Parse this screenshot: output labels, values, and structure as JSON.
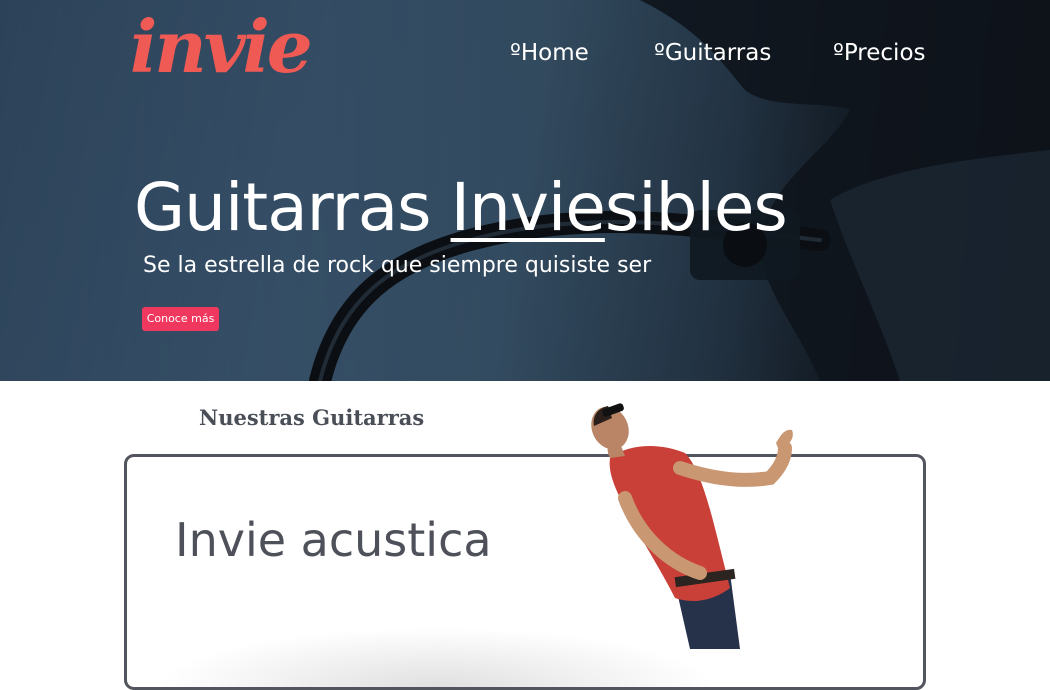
{
  "brand": {
    "logo_text": "invie",
    "logo_color": "#f05a55"
  },
  "nav": {
    "items": [
      {
        "label": "ºHome"
      },
      {
        "label": "ºGuitarras"
      },
      {
        "label": "ºPrecios"
      }
    ]
  },
  "hero": {
    "title_before": "Guitarras ",
    "title_underlined": "Invie",
    "title_after": "sibles",
    "subtitle": "Se la estrella de rock que siempre quisiste ser",
    "cta_label": "Conoce más",
    "cta_color": "#f0385e",
    "background_color": "#3a5670"
  },
  "products": {
    "section_title": "Nuestras Guitarras",
    "card": {
      "title": "Invie acustica"
    }
  },
  "icons": [
    "guitarist-photo",
    "hero-background-photo"
  ]
}
